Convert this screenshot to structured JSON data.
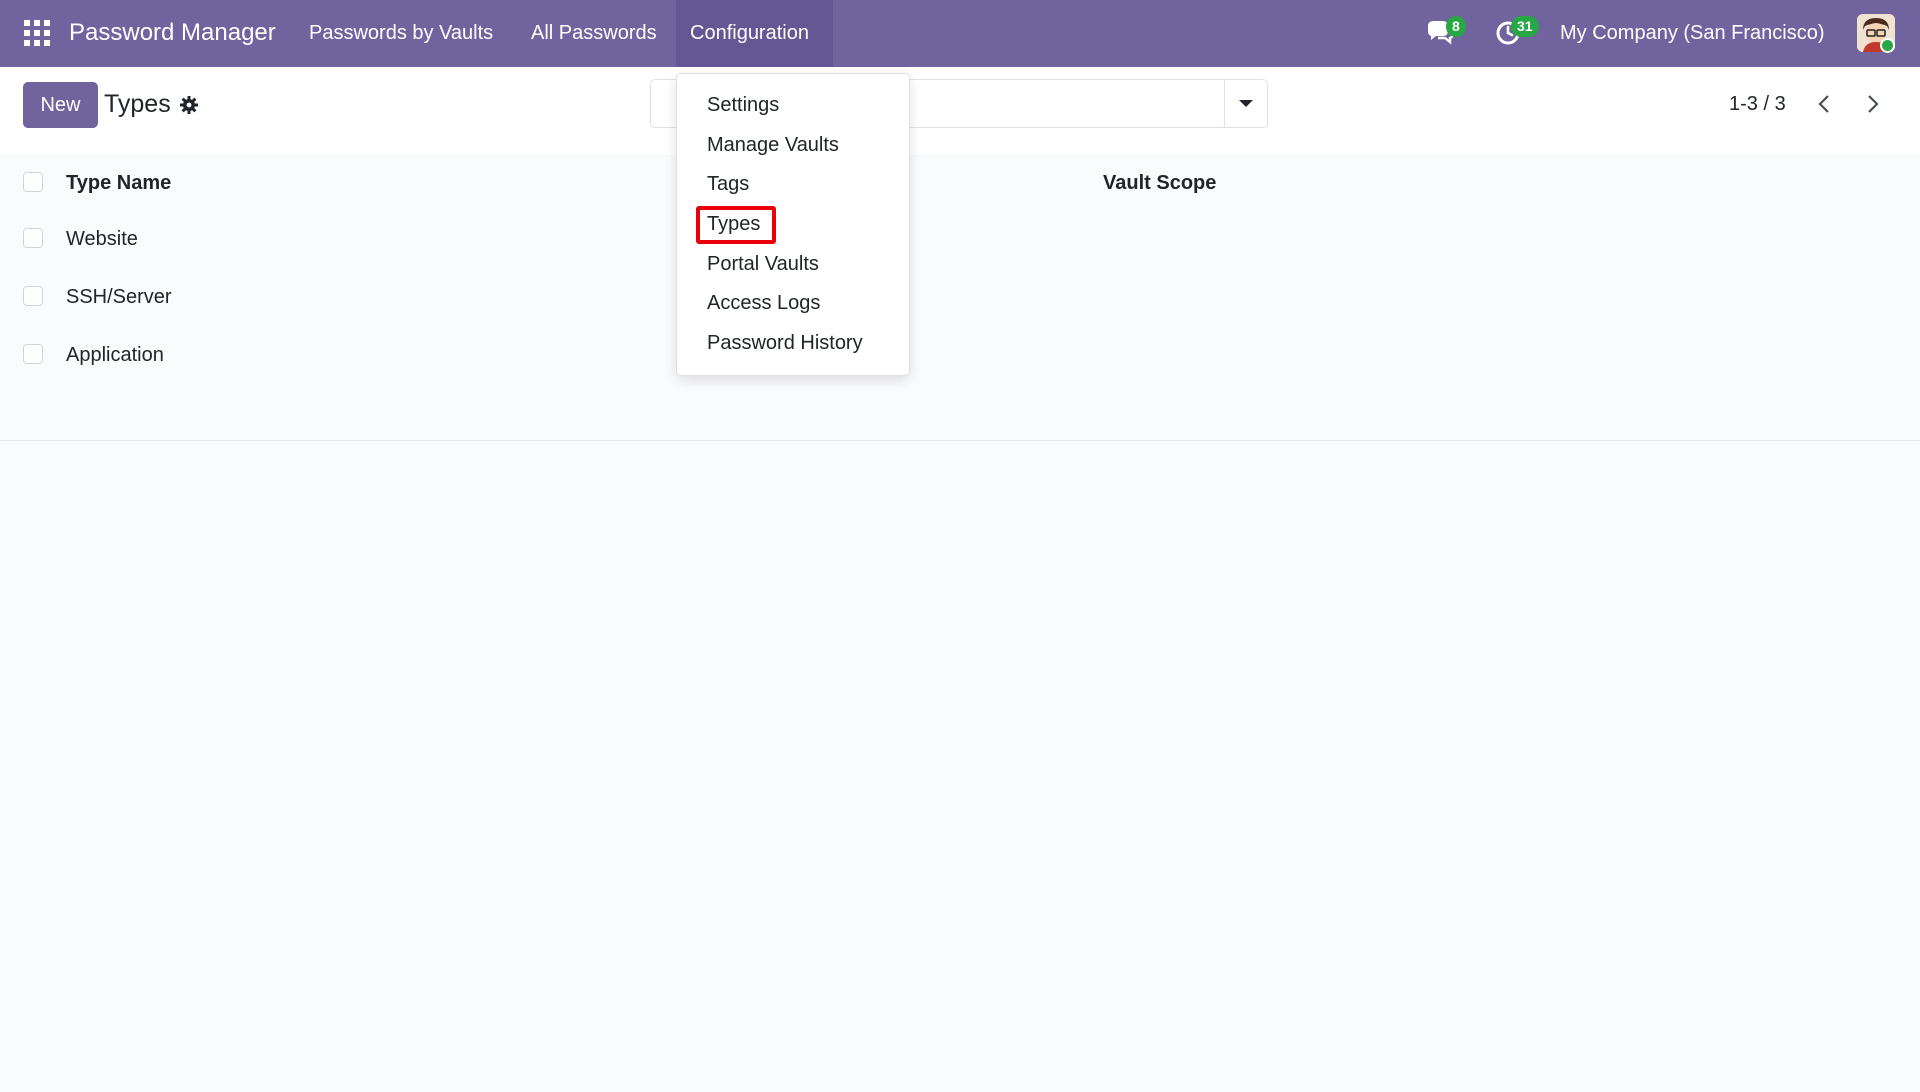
{
  "navbar": {
    "brand": "Password Manager",
    "menu": [
      {
        "label": "Passwords by Vaults"
      },
      {
        "label": "All Passwords"
      },
      {
        "label": "Configuration"
      }
    ],
    "messages_count": "8",
    "activities_count": "31",
    "company": "My Company (San Francisco)"
  },
  "control_panel": {
    "new_label": "New",
    "title": "Types",
    "search_placeholder": "",
    "pager": "1-3 / 3"
  },
  "list": {
    "columns": [
      "Type Name",
      "Vault Scope"
    ],
    "rows": [
      {
        "name": "Website"
      },
      {
        "name": "SSH/Server"
      },
      {
        "name": "Application"
      }
    ]
  },
  "dropdown": {
    "items": [
      {
        "label": "Settings"
      },
      {
        "label": "Manage Vaults"
      },
      {
        "label": "Tags"
      },
      {
        "label": "Types"
      },
      {
        "label": "Portal Vaults"
      },
      {
        "label": "Access Logs"
      },
      {
        "label": "Password History"
      }
    ],
    "highlighted": "Types"
  },
  "colors": {
    "brand": "#71639e",
    "badge": "#28a745",
    "highlight": "#e8000b"
  },
  "icons": [
    "apps-grid-icon",
    "chat-icon",
    "clock-icon",
    "gear-icon",
    "caret-down-icon",
    "chevron-left-icon",
    "chevron-right-icon",
    "avatar"
  ]
}
